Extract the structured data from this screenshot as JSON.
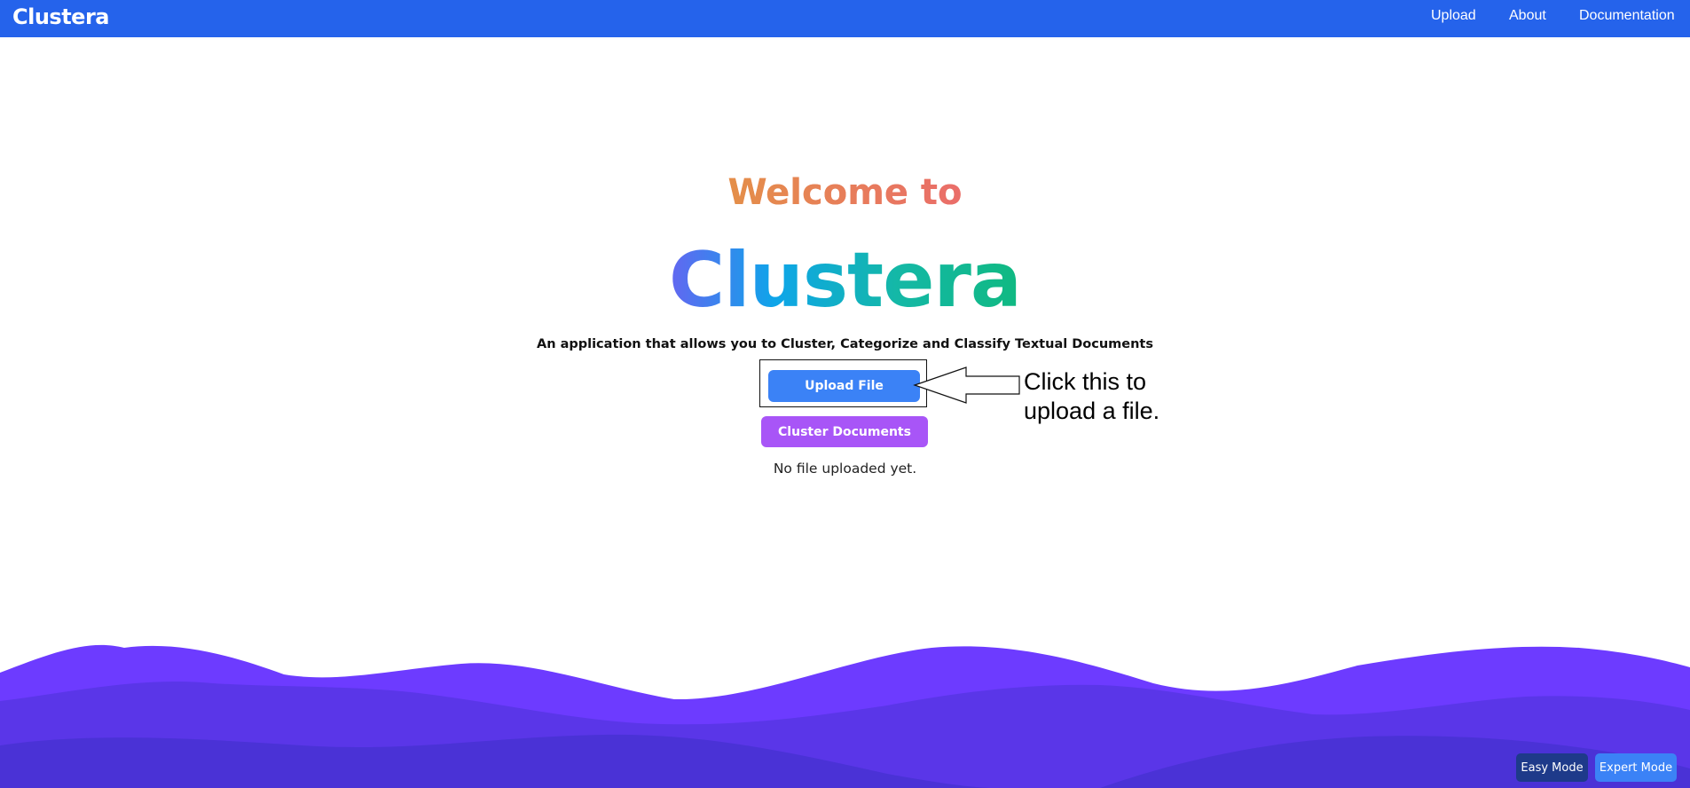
{
  "navbar": {
    "brand": "Clustera",
    "links": [
      "Upload",
      "About",
      "Documentation"
    ]
  },
  "hero": {
    "welcome": "Welcome to",
    "app_name": "Clustera",
    "tagline": "An application that allows you to Cluster, Categorize and Classify Textual Documents"
  },
  "actions": {
    "upload_label": "Upload File",
    "cluster_label": "Cluster Documents",
    "status": "No file uploaded yet."
  },
  "callout": {
    "line1": "Click this to",
    "line2": "upload a file."
  },
  "modes": {
    "easy": "Easy Mode",
    "expert": "Expert Mode"
  },
  "colors": {
    "navbar": "#2563eb",
    "upload_button": "#3b82f6",
    "cluster_button": "#a855f7",
    "wave_light": "#6d3bff",
    "wave_mid": "#5a36e8",
    "wave_dark": "#4a32d6"
  }
}
